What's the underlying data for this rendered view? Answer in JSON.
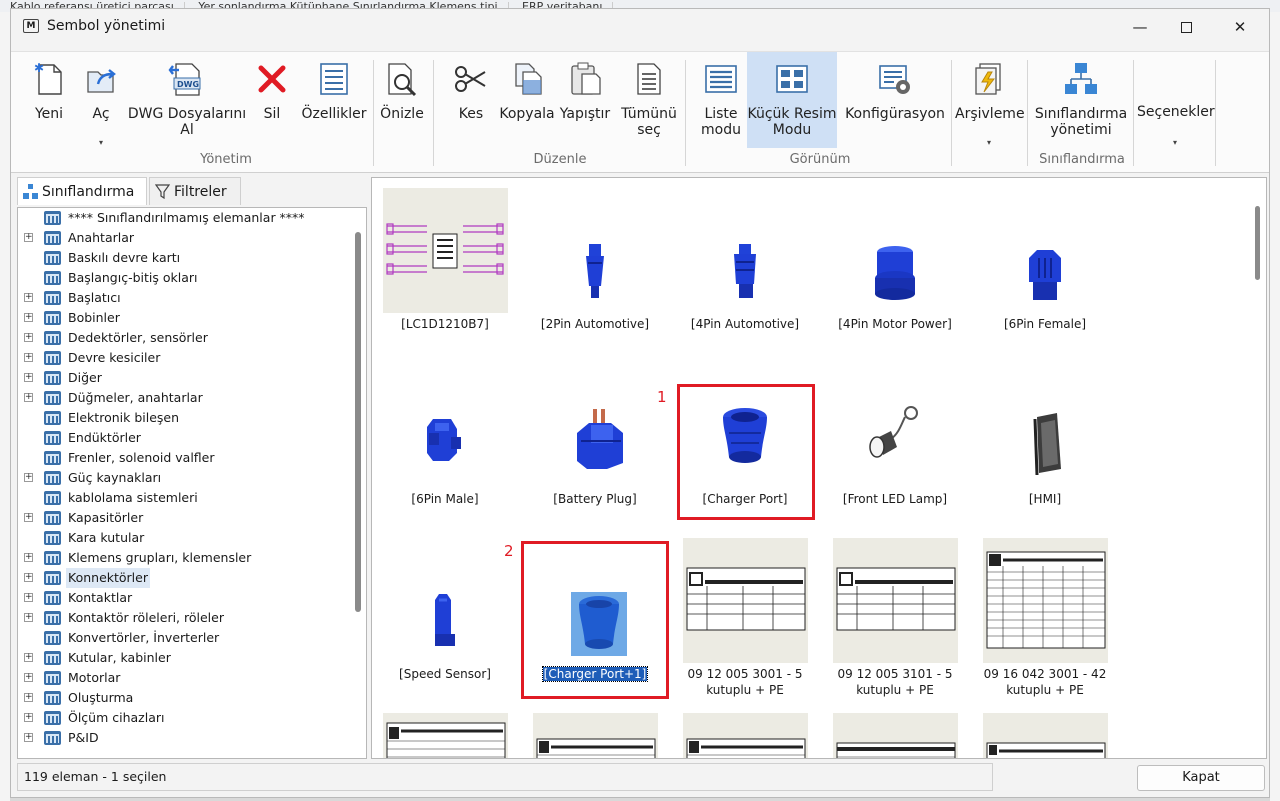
{
  "background": {
    "tabs": [
      "Kablo referansı üretici parçası",
      "Yer sonlandırma  Kütüphane  Sınırlandırma  Klemens tipi",
      "ERP veritabanı"
    ]
  },
  "window": {
    "title": "Sembol yönetimi",
    "app_icon_text": "M",
    "minimize_glyph": "—",
    "close_glyph": "✕"
  },
  "ribbon": {
    "buttons": [
      {
        "label": "Yeni",
        "icon": "new-document-icon"
      },
      {
        "label": "Aç",
        "icon": "open-folder-icon",
        "caret": "▾"
      },
      {
        "label": "DWG Dosyalarını Al",
        "icon": "dwg-import-icon"
      },
      {
        "label": "Sil",
        "icon": "delete-x-icon"
      },
      {
        "label": "Özellikler",
        "icon": "properties-icon"
      },
      {
        "label": "Önizle",
        "icon": "preview-magnifier-icon"
      },
      {
        "label": "Kes",
        "icon": "scissors-icon"
      },
      {
        "label": "Kopyala",
        "icon": "copy-icon"
      },
      {
        "label": "Yapıştır",
        "icon": "paste-icon"
      },
      {
        "label": "Tümünü seç",
        "icon": "select-all-icon"
      },
      {
        "label": "Liste modu",
        "icon": "list-mode-icon"
      },
      {
        "label": "Küçük Resim Modu",
        "icon": "thumbnail-mode-icon",
        "active": true
      },
      {
        "label": "Konfigürasyon",
        "icon": "configuration-icon"
      },
      {
        "label": "Arşivleme",
        "icon": "archive-icon",
        "caret": "▾"
      },
      {
        "label": "Sınıflandırma yönetimi",
        "icon": "classification-tree-icon"
      },
      {
        "label": "Seçenekler",
        "icon": "options-icon",
        "caret": "▾"
      }
    ],
    "groups": [
      "Yönetim",
      "Düzenle",
      "Görünüm",
      "Sınıflandırma"
    ]
  },
  "left_pane": {
    "tabs": [
      {
        "label": "Sınıflandırma",
        "icon": "classification-icon",
        "active": true
      },
      {
        "label": "Filtreler",
        "icon": "filter-funnel-icon"
      }
    ],
    "tree": [
      {
        "label": "**** Sınıflandırılmamış elemanlar ****",
        "expandable": false
      },
      {
        "label": "Anahtarlar",
        "expandable": true
      },
      {
        "label": "Baskılı devre kartı",
        "expandable": false
      },
      {
        "label": "Başlangıç-bitiş okları",
        "expandable": false
      },
      {
        "label": "Başlatıcı",
        "expandable": true
      },
      {
        "label": "Bobinler",
        "expandable": true
      },
      {
        "label": "Dedektörler, sensörler",
        "expandable": true
      },
      {
        "label": "Devre kesiciler",
        "expandable": true
      },
      {
        "label": "Diğer",
        "expandable": true
      },
      {
        "label": "Düğmeler, anahtarlar",
        "expandable": true
      },
      {
        "label": "Elektronik bileşen",
        "expandable": false
      },
      {
        "label": "Endüktörler",
        "expandable": false
      },
      {
        "label": "Frenler, solenoid valfler",
        "expandable": false
      },
      {
        "label": "Güç kaynakları",
        "expandable": true
      },
      {
        "label": "kablolama sistemleri",
        "expandable": false
      },
      {
        "label": "Kapasitörler",
        "expandable": true
      },
      {
        "label": "Kara kutular",
        "expandable": false
      },
      {
        "label": "Klemens grupları, klemensler",
        "expandable": true
      },
      {
        "label": "Konnektörler",
        "expandable": true,
        "selected": true
      },
      {
        "label": "Kontaktlar",
        "expandable": true
      },
      {
        "label": "Kontaktör röleleri, röleler",
        "expandable": true
      },
      {
        "label": "Konvertörler, İnverterler",
        "expandable": false
      },
      {
        "label": "Kutular, kabinler",
        "expandable": true
      },
      {
        "label": "Motorlar",
        "expandable": true
      },
      {
        "label": "Oluşturma",
        "expandable": true
      },
      {
        "label": "Ölçüm cihazları",
        "expandable": true
      },
      {
        "label": "P&ID",
        "expandable": true
      }
    ]
  },
  "gallery": {
    "items": [
      {
        "caption": "[LC1D1210B7]",
        "thumb": "schematic-drawing"
      },
      {
        "caption": "[2Pin Automotive]",
        "thumb": "connector-2pin"
      },
      {
        "caption": "[4Pin Automotive]",
        "thumb": "connector-4pin"
      },
      {
        "caption": "[4Pin Motor Power]",
        "thumb": "connector-motor-power"
      },
      {
        "caption": "[6Pin Female]",
        "thumb": "connector-6pin-female"
      },
      {
        "caption": "[6Pin Male]",
        "thumb": "connector-6pin-male"
      },
      {
        "caption": "[Battery Plug]",
        "thumb": "battery-plug"
      },
      {
        "caption": "[Charger Port]",
        "thumb": "charger-port"
      },
      {
        "caption": "[Front LED Lamp]",
        "thumb": "led-lamp"
      },
      {
        "caption": "[HMI]",
        "thumb": "hmi-panel"
      },
      {
        "caption": "[Speed Sensor]",
        "thumb": "speed-sensor"
      },
      {
        "caption": "[Charger Port+1]",
        "thumb": "charger-port-selected",
        "selected": true
      },
      {
        "caption": "09 12 005 3001 - 5 kutuplu + PE",
        "thumb": "table-drawing"
      },
      {
        "caption": "09 12 005 3101 - 5 kutuplu + PE",
        "thumb": "table-drawing"
      },
      {
        "caption": "09 16 042 3001 - 42 kutuplu + PE",
        "thumb": "table-drawing-dense"
      },
      {
        "caption": "",
        "thumb": "table-drawing"
      },
      {
        "caption": "",
        "thumb": "table-drawing"
      },
      {
        "caption": "",
        "thumb": "table-drawing"
      },
      {
        "caption": "",
        "thumb": "table-drawing"
      },
      {
        "caption": "",
        "thumb": "table-drawing"
      }
    ],
    "annotations": [
      "1",
      "2"
    ]
  },
  "status": {
    "text": "119 eleman - 1 seçilen"
  },
  "close_button": {
    "label": "Kapat"
  },
  "colors": {
    "accent_selected": "#1e5db8",
    "annotation_red": "#e01b24",
    "part_blue": "#1f3fd6",
    "active_ribbon": "#cfe0f5"
  }
}
